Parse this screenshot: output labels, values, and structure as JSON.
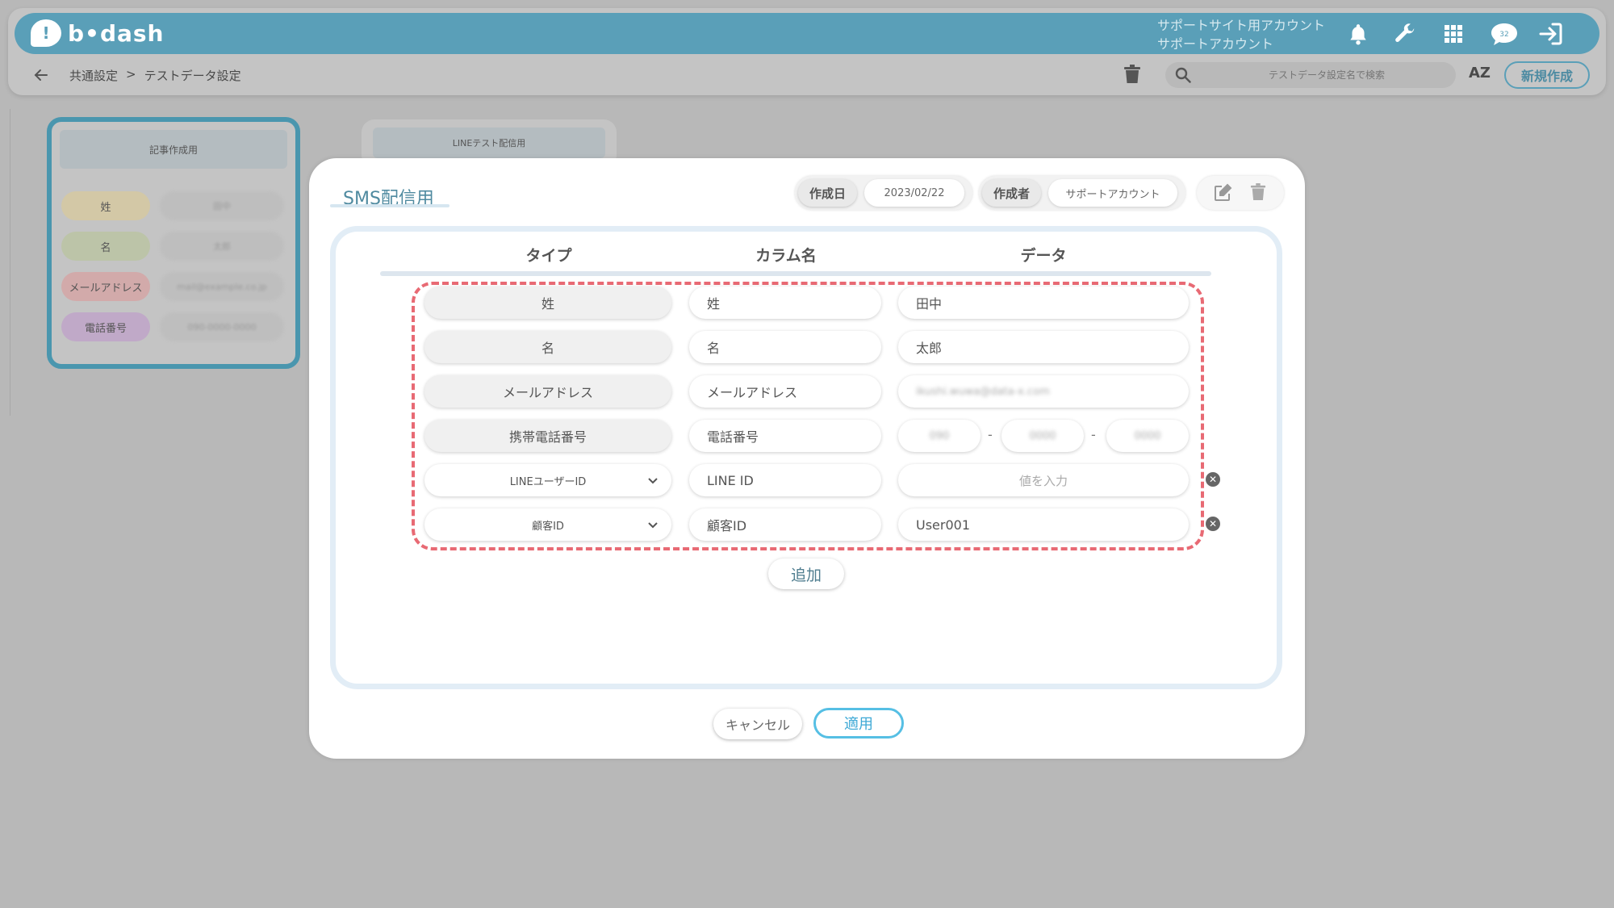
{
  "app": {
    "logo_text": "b•dash",
    "logo_mark": "!"
  },
  "header": {
    "account_line1": "サポートサイト用アカウント",
    "account_line2": "サポートアカウント",
    "badge_count": "32"
  },
  "breadcrumb": {
    "parent": "共通設定",
    "separator": ">",
    "current": "テストデータ設定"
  },
  "toolbar": {
    "search_placeholder": "テストデータ設定名で検索",
    "sort_label": "AZ",
    "new_button": "新規作成"
  },
  "background_cards": [
    {
      "title": "記事作成用",
      "fields": [
        {
          "label": "姓",
          "value": "田中",
          "color": "#d9c79a"
        },
        {
          "label": "名",
          "value": "太郎",
          "color": "#b9c39e"
        },
        {
          "label": "メールアドレス",
          "value": "mail@example.co.jp",
          "color": "#d4a5a5"
        },
        {
          "label": "電話番号",
          "value": "090-0000-0000",
          "color": "#bfa3c9"
        }
      ]
    },
    {
      "title": "LINEテスト配信用"
    }
  ],
  "modal": {
    "title": "SMS配信用",
    "created_date_label": "作成日",
    "created_date": "2023/02/22",
    "creator_label": "作成者",
    "creator": "サポートアカウント",
    "columns": {
      "type": "タイプ",
      "column_name": "カラム名",
      "data": "データ"
    },
    "rows": [
      {
        "type": "姓",
        "column": "姓",
        "data": "田中"
      },
      {
        "type": "名",
        "column": "名",
        "data": "太郎"
      },
      {
        "type": "メールアドレス",
        "column": "メールアドレス",
        "data": "ikushi.wuwa@data-x.com"
      },
      {
        "type": "携帯電話番号",
        "column": "電話番号",
        "data_parts": [
          "090",
          "0000",
          "0000"
        ],
        "separator": "-"
      },
      {
        "type": "LINEユーザーID",
        "column": "LINE ID",
        "data_placeholder": "値を入力"
      },
      {
        "type": "顧客ID",
        "column": "顧客ID",
        "data": "User001"
      }
    ],
    "add_button": "追加",
    "cancel_button": "キャンセル",
    "apply_button": "適用"
  },
  "colors": {
    "brand": "#5a9fb8",
    "accent": "#56bfe4",
    "highlight_border": "#e86a74"
  }
}
